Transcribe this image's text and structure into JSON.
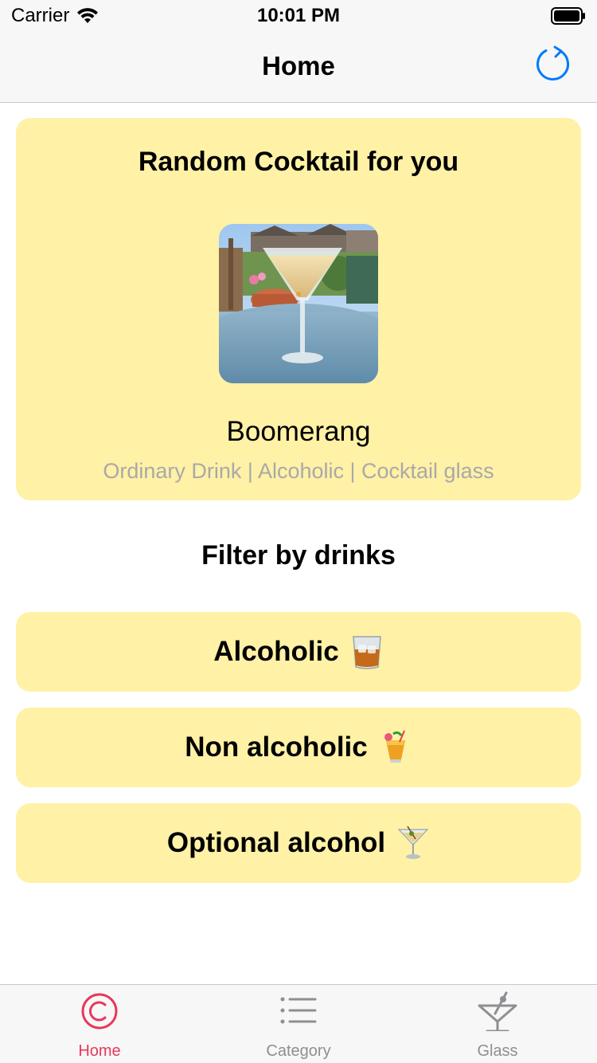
{
  "status_bar": {
    "carrier": "Carrier",
    "time": "10:01 PM"
  },
  "nav": {
    "title": "Home"
  },
  "random_card": {
    "title": "Random Cocktail for you",
    "drink_name": "Boomerang",
    "drink_meta": "Ordinary Drink | Alcoholic | Cocktail glass"
  },
  "filter": {
    "title": "Filter by drinks",
    "buttons": [
      {
        "label": "Alcoholic",
        "icon": "tumbler-glass-emoji"
      },
      {
        "label": "Non alcoholic",
        "icon": "tropical-drink-emoji"
      },
      {
        "label": "Optional alcohol",
        "icon": "cocktail-glass-emoji"
      }
    ]
  },
  "tabs": [
    {
      "label": "Home",
      "icon": "copyright-circle-icon",
      "active": true
    },
    {
      "label": "Category",
      "icon": "list-icon",
      "active": false
    },
    {
      "label": "Glass",
      "icon": "martini-glass-icon",
      "active": false
    }
  ],
  "colors": {
    "accent": "#007aff",
    "tab_active": "#e8385a",
    "tab_inactive": "#8e8e93",
    "card_bg": "#fff1a6",
    "meta_text": "#a9a9a9"
  }
}
